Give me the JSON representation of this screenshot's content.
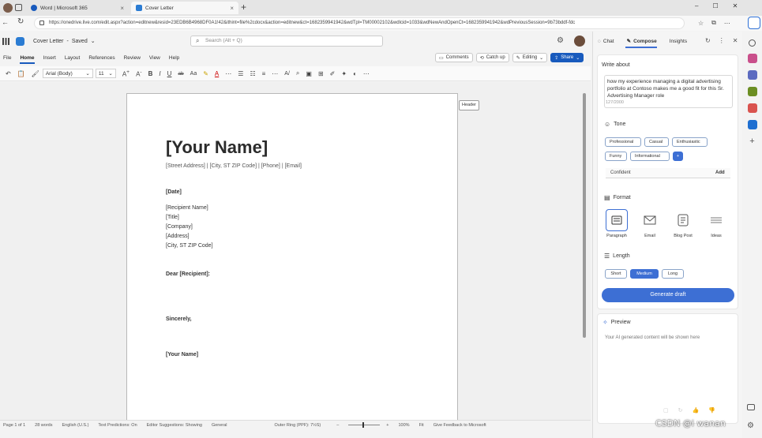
{
  "browser": {
    "tabs": [
      {
        "label": "Word | Microsoft 365"
      },
      {
        "label": "Cover Letter"
      }
    ],
    "url": "https://onedrive.live.com/edit.aspx?action=editnew&resid=23EDB6B4968DF0A1!42&ithint=file%2cdocx&action=editnew&ct=1682359941942&wdTpl=TM00002102&wdlcid=1033&wdNewAndOpenCt=1682359941942&wdPreviousSession=9b73bddf-fdc"
  },
  "word": {
    "doc_title": "Cover Letter",
    "saved_status": "Saved",
    "search_placeholder": "Search (Alt + Q)",
    "ribbon_tabs": [
      "File",
      "Home",
      "Insert",
      "Layout",
      "References",
      "Review",
      "View",
      "Help"
    ],
    "comments_label": "Comments",
    "catchup_label": "Catch up",
    "editing_label": "Editing",
    "share_label": "Share",
    "font_name": "Arial (Body)",
    "font_size": "11",
    "header_tag": "Header"
  },
  "document": {
    "name": "[Your Name]",
    "contact": "[Street Address] | [City, ST ZIP Code] | [Phone] | [Email]",
    "date": "[Date]",
    "recipient_name": "[Recipient Name]",
    "title": "[Title]",
    "company": "[Company]",
    "address": "[Address]",
    "city": "[City, ST ZIP Code]",
    "salutation": "Dear [Recipient]:",
    "closing": "Sincerely,",
    "signature": "[Your Name]"
  },
  "statusbar": {
    "page": "Page 1 of 1",
    "words": "28 words",
    "language": "English (U.S.)",
    "predictions": "Text Predictions: On",
    "suggestions": "Editor Suggestions: Showing",
    "general": "General",
    "outline": "Outer Ring (PPF): 7½S)",
    "zoom": "100%",
    "fit": "Fit",
    "feedback": "Give Feedback to Microsoft"
  },
  "copilot": {
    "tabs": [
      "Chat",
      "Compose",
      "Insights"
    ],
    "write_about_label": "Write about",
    "prompt_text": "how my experience managing a digital advertising portfolio at Contoso makes me a good fit for this Sr. Advertising Manager role",
    "char_count": "127/2000",
    "tone_label": "Tone",
    "tones": [
      "Professional",
      "Casual",
      "Enthusiastic",
      "Funny",
      "Informational"
    ],
    "tone_add_symbol": "+",
    "custom_tone_value": "Confident",
    "custom_tone_add": "Add",
    "format_label": "Format",
    "formats": [
      "Paragraph",
      "Email",
      "Blog Post",
      "Ideas"
    ],
    "length_label": "Length",
    "lengths": [
      "Short",
      "Medium",
      "Long"
    ],
    "generate_label": "Generate draft",
    "preview_label": "Preview",
    "preview_placeholder": "Your AI generated content will be shown here"
  },
  "watermark": "CSDN @i wanan",
  "colors": {
    "accent": "#3d6fd4",
    "word_blue": "#185abd"
  }
}
